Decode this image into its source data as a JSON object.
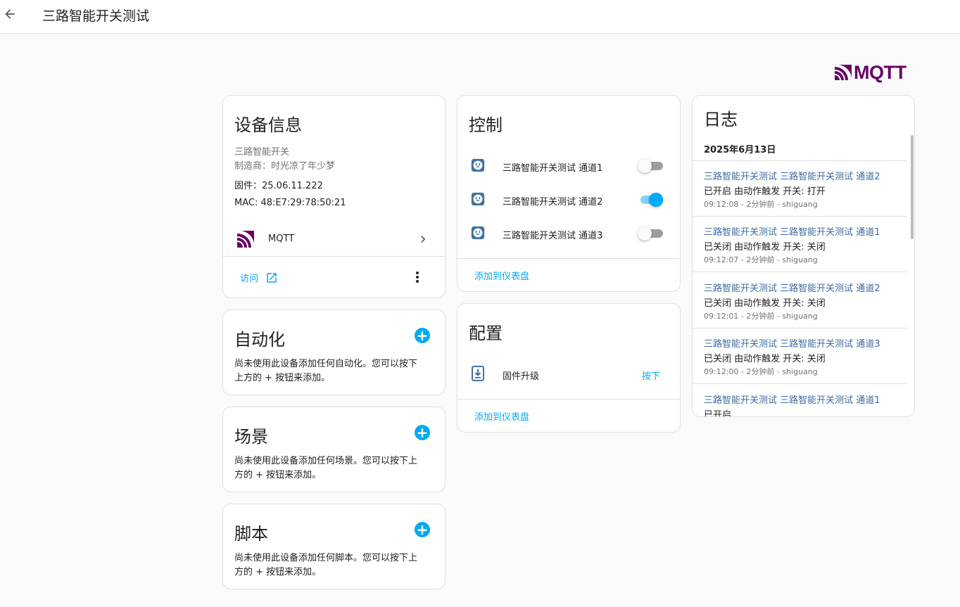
{
  "header": {
    "title": "三路智能开关测试"
  },
  "brand": {
    "logo_text": "MQTT",
    "logo_color": "#660066"
  },
  "colors": {
    "accent": "#03a9f4",
    "log_link": "#3f6ba0"
  },
  "device_info": {
    "title": "设备信息",
    "model": "三路智能开关",
    "manufacturer": "制造商：时光凉了年少梦",
    "firmware": "固件：25.06.11.222",
    "mac": "MAC: 48:E7:29:78:50:21",
    "integration": "MQTT",
    "visit": "访问"
  },
  "controls": {
    "title": "控制",
    "items": [
      {
        "label": "三路智能开关测试 通道1",
        "on": false
      },
      {
        "label": "三路智能开关测试 通道2",
        "on": true
      },
      {
        "label": "三路智能开关测试 通道3",
        "on": false
      }
    ],
    "add_dashboard": "添加到仪表盘"
  },
  "config": {
    "title": "配置",
    "item_label": "固件升级",
    "item_action": "按下",
    "add_dashboard": "添加到仪表盘"
  },
  "automation": {
    "title": "自动化",
    "desc_line1": "尚未使用此设备添加任何自动化。您可以按下",
    "desc_line2": "上方的 + 按钮来添加。"
  },
  "scenes": {
    "title": "场景",
    "desc_line1": "尚未使用此设备添加任何场景。您可以按下上",
    "desc_line2": "方的 + 按钮来添加。"
  },
  "scripts": {
    "title": "脚本",
    "desc_line1": "尚未使用此设备添加任何脚本。您可以按下上",
    "desc_line2": "方的 + 按钮来添加。"
  },
  "logbook": {
    "title": "日志",
    "date": "2025年6月13日",
    "entries": [
      {
        "name": "三路智能开关测试 三路智能开关测试 通道2",
        "message": "已开启 由动作触发 开关: 打开",
        "meta": "09:12:08 - 2分钟前 - shiguang"
      },
      {
        "name": "三路智能开关测试 三路智能开关测试 通道1",
        "message": "已关闭 由动作触发 开关: 关闭",
        "meta": "09:12:07 - 2分钟前 - shiguang"
      },
      {
        "name": "三路智能开关测试 三路智能开关测试 通道2",
        "message": "已关闭 由动作触发 开关: 关闭",
        "meta": "09:12:01 - 2分钟前 - shiguang"
      },
      {
        "name": "三路智能开关测试 三路智能开关测试 通道3",
        "message": "已关闭 由动作触发 开关: 关闭",
        "meta": "09:12:00 - 2分钟前 - shiguang"
      },
      {
        "name": "三路智能开关测试 三路智能开关测试 通道1",
        "message": "已开启",
        "meta": ""
      }
    ]
  }
}
